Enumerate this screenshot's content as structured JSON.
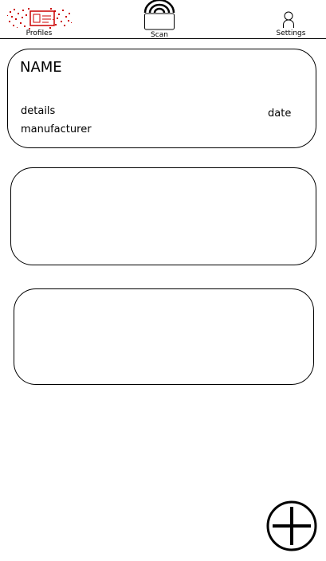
{
  "nav": {
    "profiles_label": "Profiles",
    "scan_label": "Scan",
    "settings_label": "Settings"
  },
  "cards": [
    {
      "name": "NAME",
      "details": "details",
      "manufacturer": "manufacturer",
      "date": "date"
    },
    {},
    {}
  ],
  "icons": {
    "profiles": "profiles-icon",
    "scan": "scan-icon",
    "settings": "person-icon",
    "add": "add-circle-icon"
  },
  "colors": {
    "profiles_icon": "#cc0000",
    "outline": "#000000",
    "background": "#ffffff"
  }
}
